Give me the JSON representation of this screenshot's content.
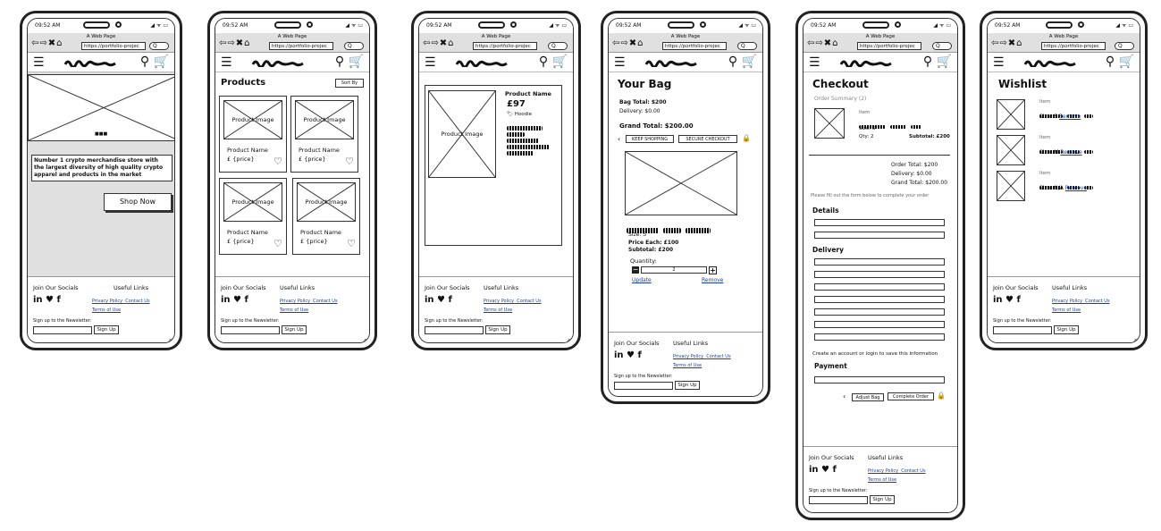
{
  "status_time": "09:52 AM",
  "browser": {
    "title": "A Web Page",
    "url": "https://portfolio-projec",
    "search_glyph": "Q"
  },
  "footer": {
    "socials_title": "Join Our Socials",
    "links_title": "Useful Links",
    "privacy": "Privacy Policy",
    "contact": "Contact Us",
    "terms": "Terms of Use",
    "newsletter": "Sign up to the Newsletter:",
    "signup": "Sign Up",
    "social_icons": "in ♥ f"
  },
  "home": {
    "dots": "■■■",
    "tagline": "Number 1 crypto merchandise store with the largest diversity of high quality crypto apparel and products in the market",
    "shop_btn": "Shop Now"
  },
  "products": {
    "title": "Products",
    "sort": "Sort By",
    "items": [
      {
        "img": "Product Image",
        "name": "Product Name",
        "price": "£ {price}"
      },
      {
        "img": "Product Image",
        "name": "Product Name",
        "price": "£ {price}"
      },
      {
        "img": "Product Image",
        "name": "Product Name",
        "price": "£ {price}"
      },
      {
        "img": "Product Image",
        "name": "Product Name",
        "price": "£ {price}"
      }
    ]
  },
  "detail": {
    "img": "Product Image",
    "name": "Product Name",
    "price": "£97",
    "tag": "Hoodie"
  },
  "bag": {
    "title": "Your Bag",
    "bag_total": "Bag Total: $200",
    "delivery": "Delivery: $0.00",
    "grand": "Grand Total: $200.00",
    "keep": "KEEP SHOPPING",
    "secure": "SECURE CHECKOUT",
    "size": "Size: S",
    "price_each": "Price Each: £100",
    "subtotal": "Subtotal: £200",
    "quantity_label": "Quantity:",
    "qty": "2",
    "update": "Update",
    "remove": "Remove"
  },
  "checkout": {
    "title": "Checkout",
    "summary": "Order Summary (2)",
    "item": "Item",
    "size": "Size: S",
    "qty": "Qty: 2",
    "subtotal": "Subtotal: £200",
    "order_total": "Order Total: $200",
    "delivery": "Delivery: $0.00",
    "grand": "Grand Total: $200.00",
    "fill_note": "Please fill out the form below to complete your order",
    "details": "Details",
    "delivery_head": "Delivery",
    "account_note": "Create an account or login to save this information",
    "payment": "Payment",
    "adjust": "Adjust Bag",
    "complete": "Complete Order"
  },
  "wishlist": {
    "title": "Wishlist",
    "items": [
      {
        "item": "Item",
        "size": "Size: S",
        "remove": "Remove"
      },
      {
        "item": "Item",
        "size": "Size: M",
        "remove": "Remove"
      },
      {
        "item": "Item",
        "size": "Size: N/A",
        "remove": "Remove"
      }
    ]
  }
}
